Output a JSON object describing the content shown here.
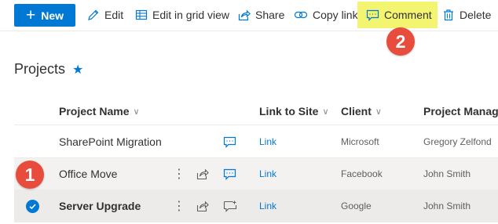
{
  "toolbar": {
    "new_label": "New",
    "edit_label": "Edit",
    "grid_label": "Edit in grid view",
    "share_label": "Share",
    "copy_link_label": "Copy link",
    "comment_label": "Comment",
    "delete_label": "Delete"
  },
  "annotations": {
    "step1": "1",
    "step2": "2"
  },
  "page": {
    "title": "Projects",
    "favorite_icon": "star-icon"
  },
  "columns": {
    "name": "Project Name",
    "link": "Link to Site",
    "client": "Client",
    "manager": "Project Manage"
  },
  "rows": [
    {
      "name": "SharePoint Migration",
      "link": "Link",
      "client": "Microsoft",
      "manager": "Gregory Zelfond",
      "selected": false
    },
    {
      "name": "Office Move",
      "link": "Link",
      "client": "Facebook",
      "manager": "John Smith",
      "selected": false
    },
    {
      "name": "Server Upgrade",
      "link": "Link",
      "client": "Google",
      "manager": "John Smith",
      "selected": true
    }
  ],
  "colors": {
    "accent": "#0078d4",
    "highlight": "#f3f46f",
    "badge": "#e74c3c",
    "selected_row": "#edebe9"
  }
}
